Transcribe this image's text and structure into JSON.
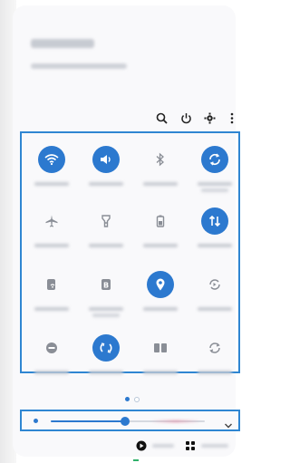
{
  "colors": {
    "accent": "#2c79cf",
    "outline": "#2f86d2",
    "off_icon": "#8a8e96",
    "panel": "#f9f9fb",
    "dot_inactive": "#b9c7d8"
  },
  "header": {
    "time_text": "",
    "date_text": ""
  },
  "header_icons": [
    {
      "name": "search-icon"
    },
    {
      "name": "power-icon"
    },
    {
      "name": "gear-icon"
    },
    {
      "name": "more-vertical-icon"
    }
  ],
  "tiles": [
    {
      "name": "wifi-icon",
      "active": true
    },
    {
      "name": "sound-icon",
      "active": true
    },
    {
      "name": "bluetooth-icon",
      "active": false
    },
    {
      "name": "auto-rotate-icon",
      "active": true
    },
    {
      "name": "airplane-mode-icon",
      "active": false
    },
    {
      "name": "flashlight-icon",
      "active": false
    },
    {
      "name": "battery-saver-icon",
      "active": false
    },
    {
      "name": "mobile-data-icon",
      "active": true
    },
    {
      "name": "hotspot-icon",
      "active": false
    },
    {
      "name": "b-badge-icon",
      "active": false
    },
    {
      "name": "location-icon",
      "active": true
    },
    {
      "name": "sync-icon",
      "active": false
    },
    {
      "name": "do-not-disturb-icon",
      "active": false
    },
    {
      "name": "nearby-share-icon",
      "active": true
    },
    {
      "name": "dual-screen-icon",
      "active": false
    },
    {
      "name": "refresh-icon",
      "active": false
    }
  ],
  "pager": {
    "pages": 2,
    "current": 1
  },
  "brightness": {
    "level": 0.48
  },
  "bottom_bar": [
    {
      "name": "media-icon"
    },
    {
      "name": "devices-icon"
    }
  ]
}
